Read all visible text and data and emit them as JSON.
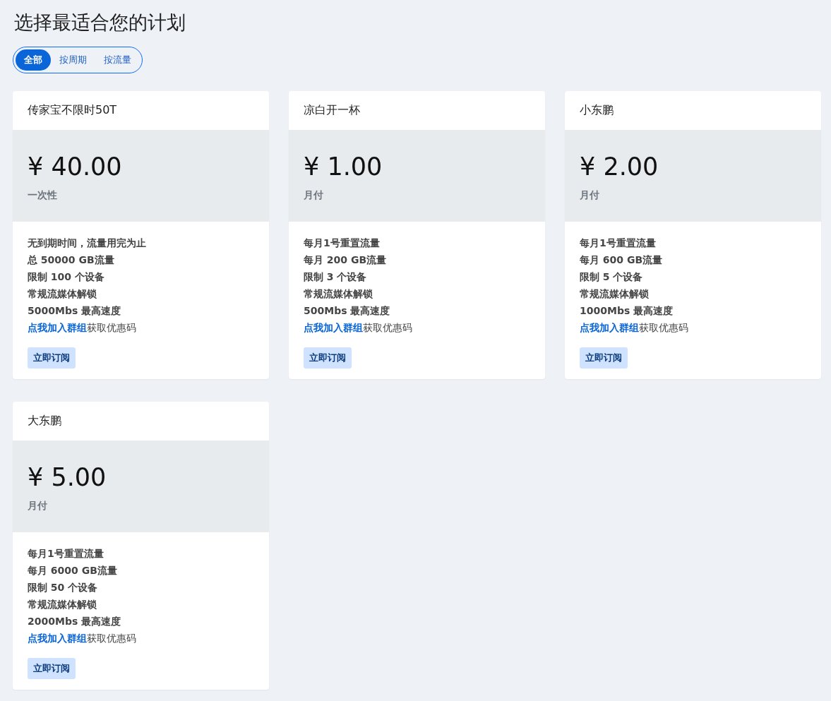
{
  "title": "选择最适合您的计划",
  "filters": [
    {
      "label": "全部",
      "selected": true
    },
    {
      "label": "按周期",
      "selected": false
    },
    {
      "label": "按流量",
      "selected": false
    }
  ],
  "plans": [
    {
      "name": "传家宝不限时50T",
      "price": "¥ 40.00",
      "period": "一次性",
      "features": [
        "无到期时间，流量用完为止",
        "总 50000 GB流量",
        "限制 100 个设备",
        "常规流媒体解锁",
        "5000Mbs 最高速度"
      ],
      "link": "点我加入群组",
      "link_suffix": "获取优惠码",
      "button": "立即订阅"
    },
    {
      "name": "凉白开一杯",
      "price": "¥ 1.00",
      "period": "月付",
      "features": [
        "每月1号重置流量",
        "每月 200 GB流量",
        "限制 3 个设备",
        "常规流媒体解锁",
        "500Mbs 最高速度"
      ],
      "link": "点我加入群组",
      "link_suffix": "获取优惠码",
      "button": "立即订阅"
    },
    {
      "name": "小东鹏",
      "price": "¥ 2.00",
      "period": "月付",
      "features": [
        "每月1号重置流量",
        "每月 600 GB流量",
        "限制 5 个设备",
        "常规流媒体解锁",
        "1000Mbs 最高速度"
      ],
      "link": "点我加入群组",
      "link_suffix": "获取优惠码",
      "button": "立即订阅"
    },
    {
      "name": "大东鹏",
      "price": "¥ 5.00",
      "period": "月付",
      "features": [
        "每月1号重置流量",
        "每月 6000 GB流量",
        "限制 50 个设备",
        "常规流媒体解锁",
        "2000Mbs 最高速度"
      ],
      "link": "点我加入群组",
      "link_suffix": "获取优惠码",
      "button": "立即订阅"
    }
  ]
}
